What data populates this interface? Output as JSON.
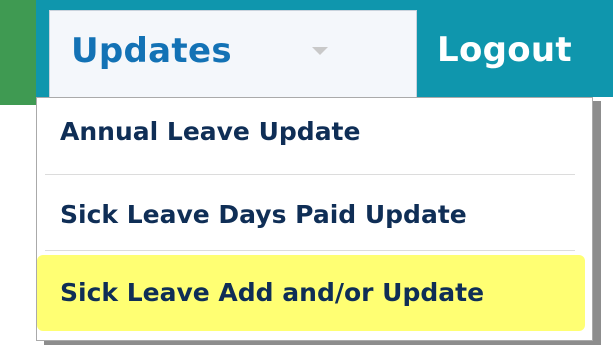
{
  "nav": {
    "updates_label": "Updates",
    "logout_label": "Logout",
    "colors": {
      "bar": "#0f96ad",
      "left_accent": "#3f9a52",
      "tab_background": "#f4f7fb",
      "tab_text": "#1372b5",
      "highlight": "#ffff5a"
    },
    "updates_icon": "chevron-down-icon"
  },
  "dropdown": {
    "items": [
      {
        "label": "Annual Leave Update"
      },
      {
        "label": "Sick Leave Days Paid Update"
      },
      {
        "label": "Sick Leave Add and/or Update",
        "highlighted": true
      }
    ]
  }
}
